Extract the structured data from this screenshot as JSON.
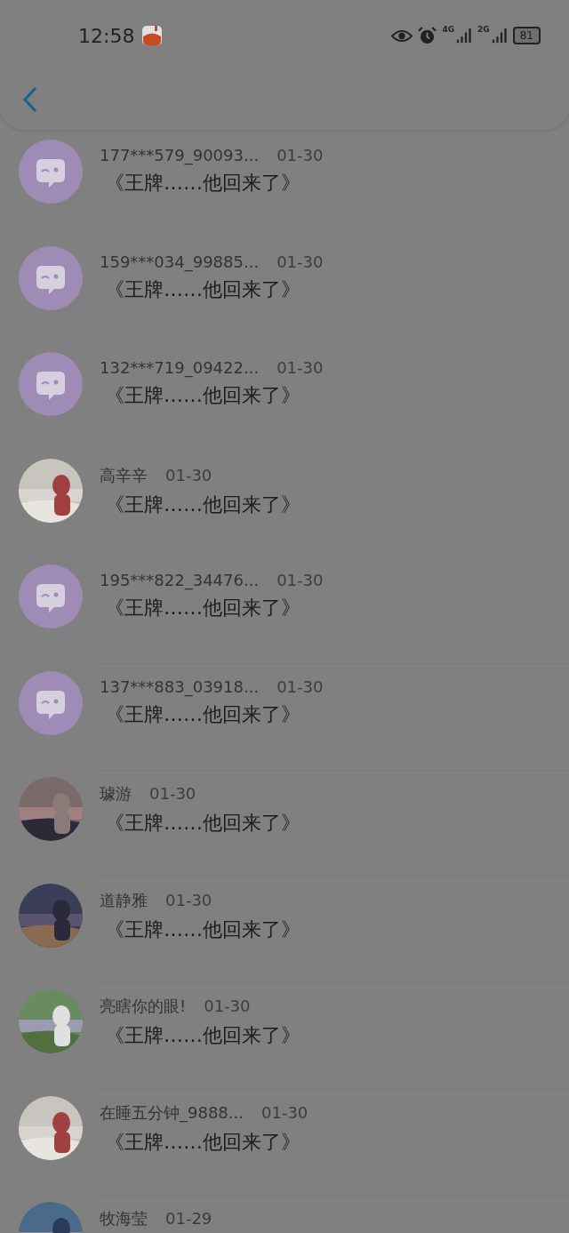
{
  "status_bar": {
    "time": "12:58",
    "network_1": "4G",
    "network_2": "2G",
    "battery": "81"
  },
  "messages": [
    {
      "avatar": {
        "kind": "default"
      },
      "name": "177***579_90093...",
      "date": "01-30",
      "text": "《王牌……他回来了》"
    },
    {
      "avatar": {
        "kind": "default"
      },
      "name": "159***034_99885...",
      "date": "01-30",
      "text": "《王牌……他回来了》"
    },
    {
      "avatar": {
        "kind": "default"
      },
      "name": "132***719_09422...",
      "date": "01-30",
      "text": "《王牌……他回来了》"
    },
    {
      "name": "高辛辛",
      "date": "01-30",
      "text": "《王牌……他回来了》"
    },
    {
      "avatar": {
        "kind": "default"
      },
      "name": "195***822_34476...",
      "date": "01-30",
      "text": "《王牌……他回来了》"
    },
    {
      "avatar": {
        "kind": "default"
      },
      "name": "137***883_03918...",
      "date": "01-30",
      "text": "《王牌……他回来了》"
    },
    {
      "name": "璩游",
      "date": "01-30",
      "text": "《王牌……他回来了》"
    },
    {
      "name": "道静雅",
      "date": "01-30",
      "text": "《王牌……他回来了》"
    },
    {
      "name": "亮瞎你的眼!",
      "date": "01-30",
      "text": "《王牌……他回来了》"
    },
    {
      "name": "在睡五分钟_9888...",
      "date": "01-30",
      "text": "《王牌……他回来了》"
    },
    {
      "name": "牧海莹",
      "date": "01-29"
    }
  ]
}
